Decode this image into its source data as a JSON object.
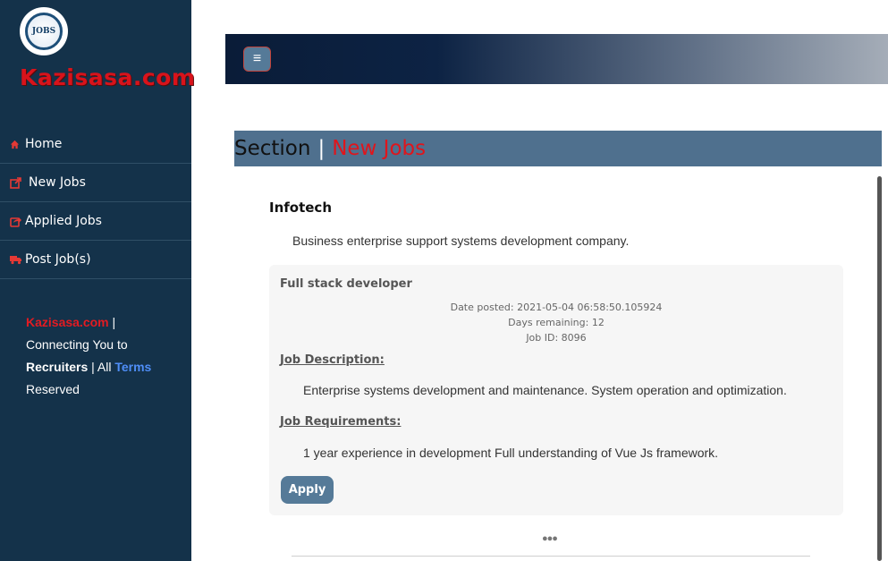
{
  "sidebar": {
    "logo_text": "JOBS",
    "brand": "Kazisasa.com",
    "items": [
      {
        "label": "Home",
        "icon": "home-icon"
      },
      {
        "label": "New Jobs",
        "icon": "external-link-icon"
      },
      {
        "label": "Applied Jobs",
        "icon": "share-square-icon"
      },
      {
        "label": "Post Job(s)",
        "icon": "truck-icon"
      }
    ],
    "footer": {
      "brand": "Kazisasa.com",
      "pipe": " |",
      "line1": "Connecting You to",
      "recruiters": "Recruiters",
      "all": " | All ",
      "terms": "Terms",
      "reserved": "Reserved"
    }
  },
  "header": {
    "menu_icon": "≡"
  },
  "section": {
    "title": "Section",
    "separator": "|",
    "subtitle": "New Jobs"
  },
  "company": {
    "name": "Infotech",
    "description": "Business enterprise support systems development company."
  },
  "job": {
    "title": "Full stack developer",
    "date_posted": "Date posted: 2021-05-04 06:58:50.105924",
    "days_remaining": "Days remaining: 12",
    "job_id": "Job ID: 8096",
    "description_heading": "Job Description:",
    "description": "Enterprise systems development and maintenance. System operation and optimization.",
    "requirements_heading": "Job Requirements:",
    "requirements": "1 year experience in development Full understanding of Vue Js framework.",
    "apply_label": "Apply"
  },
  "pager": {
    "dots": "●●●"
  },
  "colors": {
    "sidebar_bg": "#14324a",
    "accent_red": "#e0151c",
    "button_bg": "#557a98",
    "section_bg": "#4f708e"
  }
}
